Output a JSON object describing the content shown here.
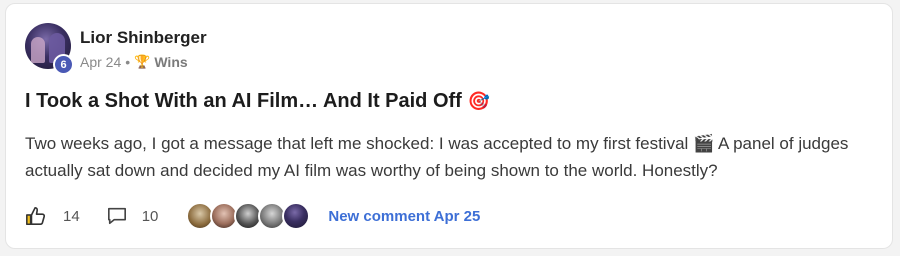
{
  "post": {
    "author": "Lior Shinberger",
    "level": "6",
    "date": "Apr 24",
    "separator": "•",
    "category_icon": "trophy-icon",
    "category": "Wins",
    "title": "I Took a Shot With an AI Film… And It Paid Off",
    "title_emoji": "🎯",
    "body": "Two weeks ago, I got a message that left me shocked: I was accepted to my first festival 🎬 A panel of judges actually sat down and decided my AI film was worthy of being shown to the world. Honestly?"
  },
  "footer": {
    "likes": "14",
    "comments": "10",
    "new_comment": "New comment Apr 25"
  },
  "colors": {
    "accent_link": "#3d6fd6",
    "level_badge": "#4a59b5",
    "trophy": "#c79216"
  }
}
